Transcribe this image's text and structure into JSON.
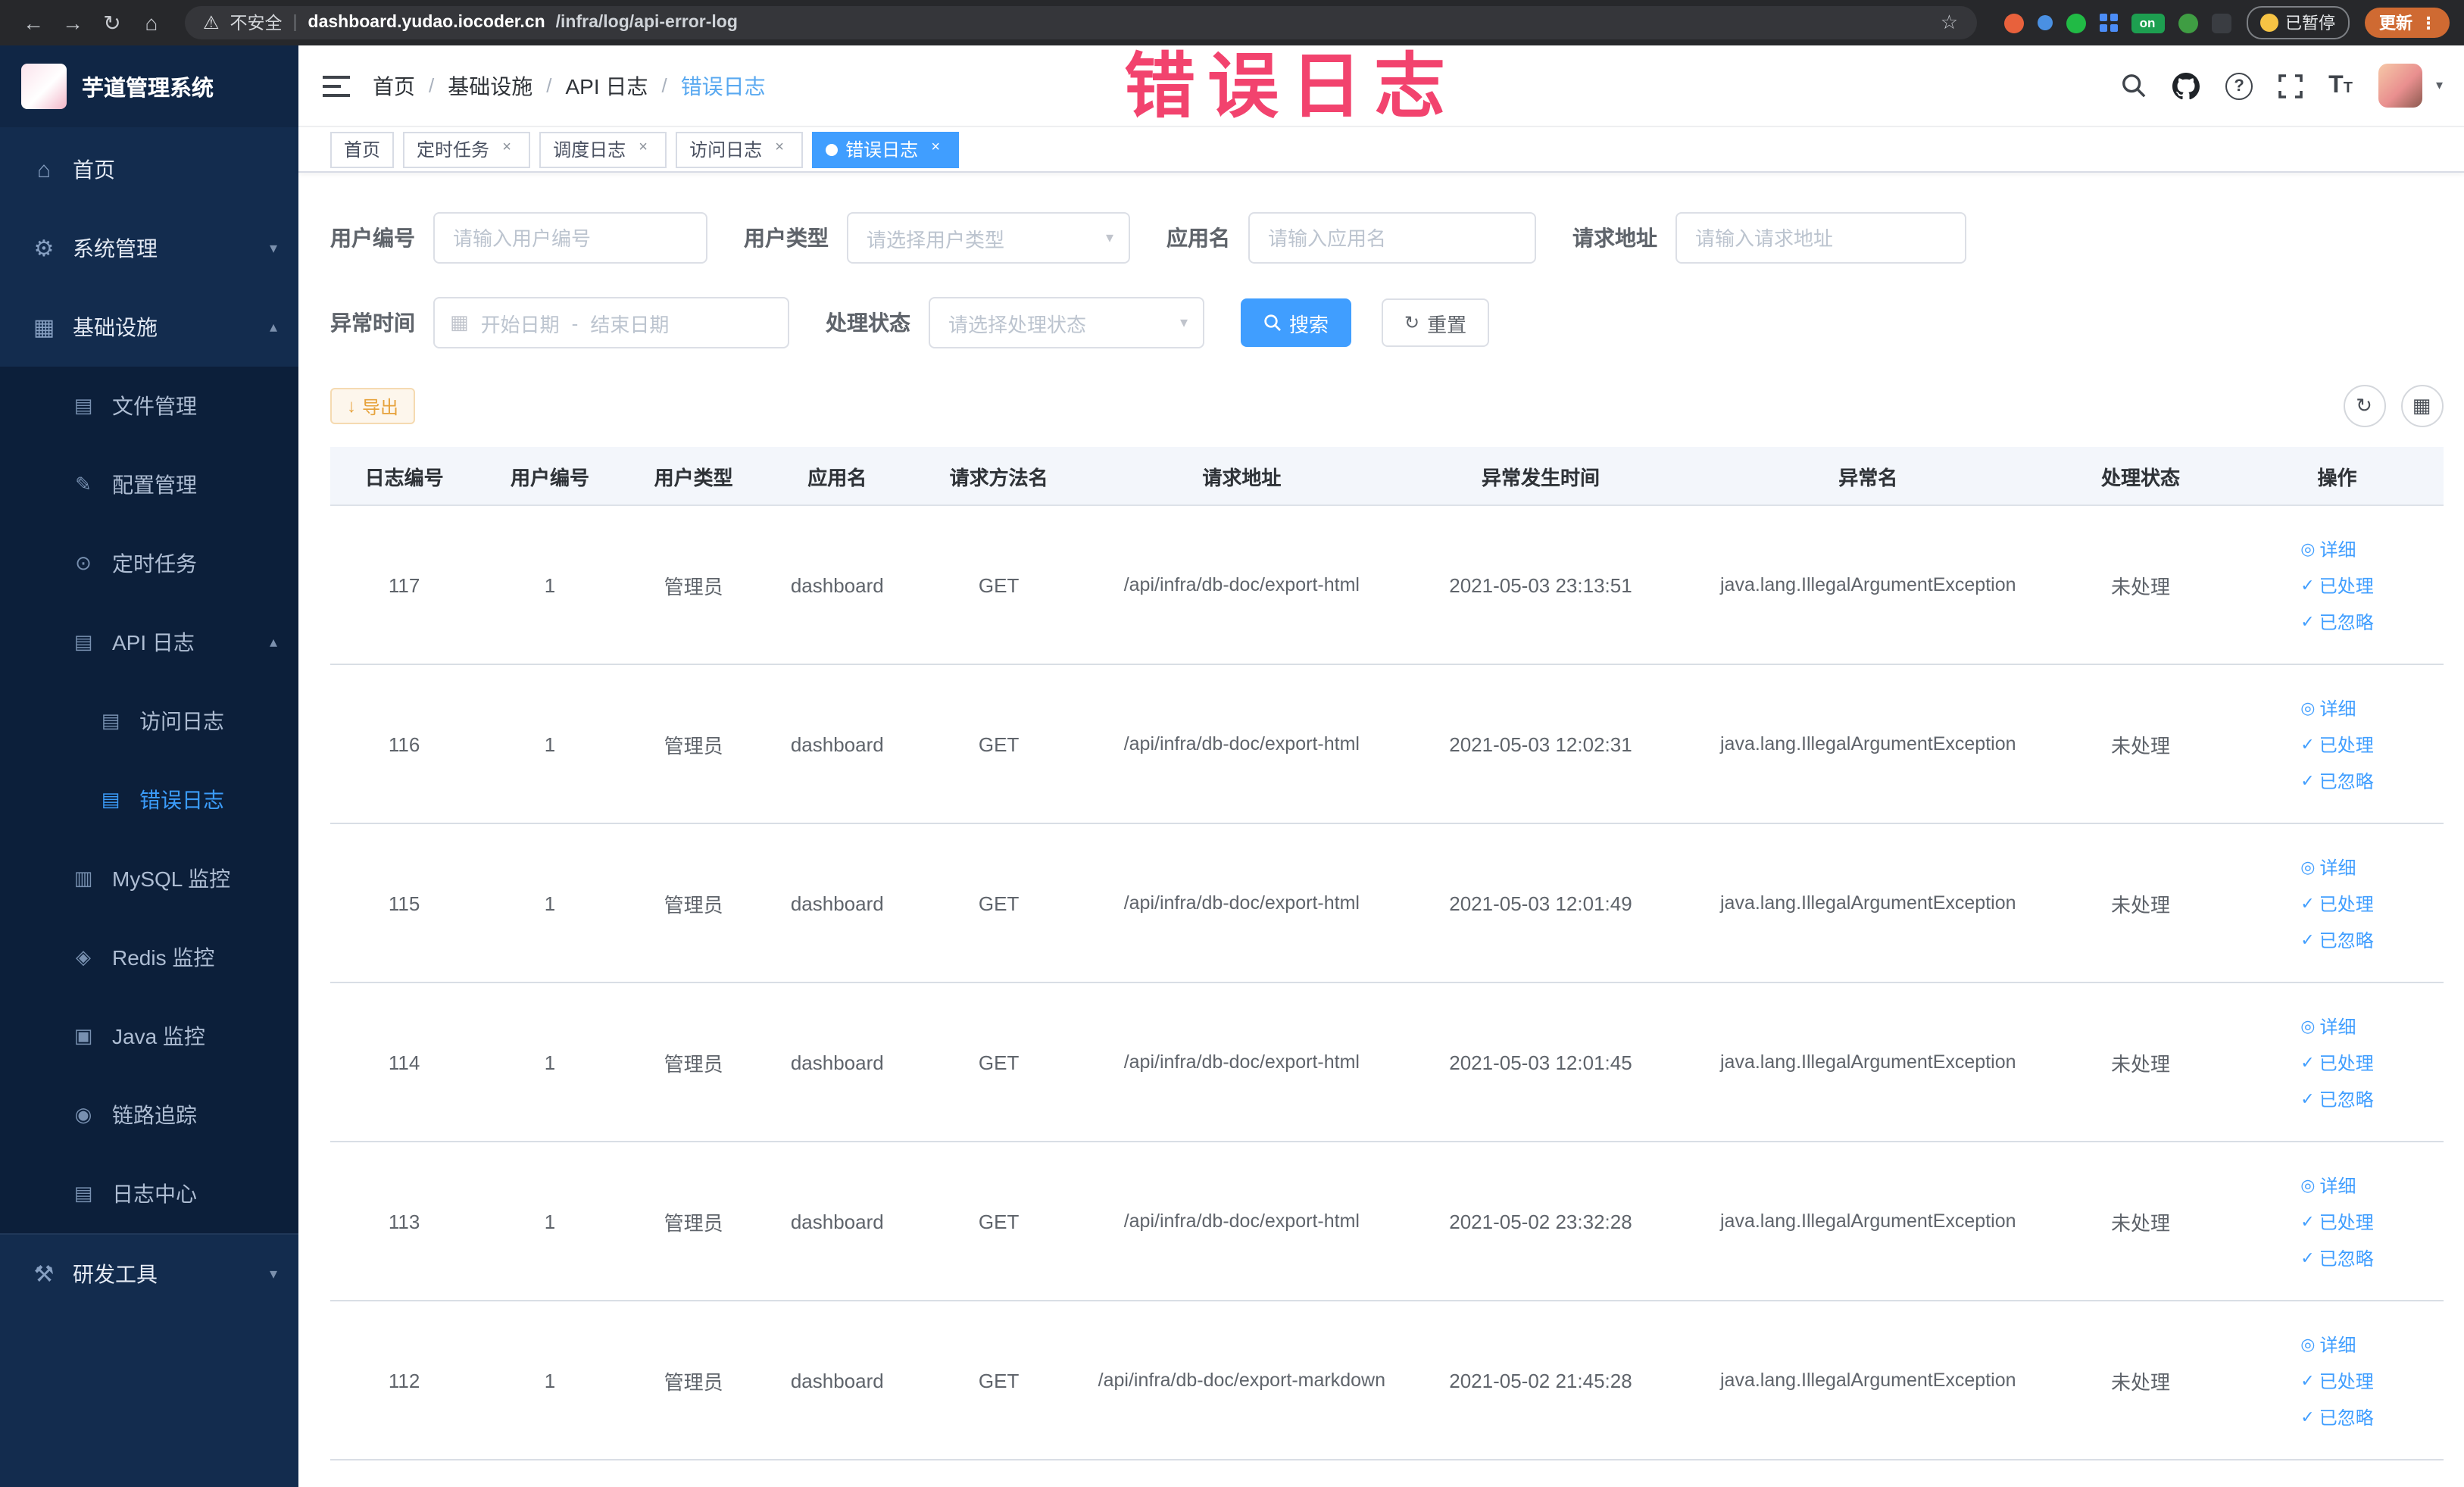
{
  "colors": {
    "primary": "#409eff",
    "annotation": "#f2436e",
    "warning_button": "#e6a23c",
    "active_tab": "#409eff"
  },
  "browser": {
    "insecure_label": "不安全",
    "url_domain": "dashboard.yudao.iocoder.cn",
    "url_path": "/infra/log/api-error-log",
    "paused_badge": "已暂停",
    "update_button": "更新",
    "extension_on_badge": "on"
  },
  "annotation": {
    "text": "错误日志"
  },
  "sidebar": {
    "title": "芋道管理系统",
    "menu": [
      {
        "label": "首页"
      },
      {
        "label": "系统管理"
      },
      {
        "label": "基础设施"
      },
      {
        "label": "文件管理"
      },
      {
        "label": "配置管理"
      },
      {
        "label": "定时任务"
      },
      {
        "label": "API 日志"
      },
      {
        "label": "访问日志"
      },
      {
        "label": "错误日志"
      },
      {
        "label": "MySQL 监控"
      },
      {
        "label": "Redis 监控"
      },
      {
        "label": "Java 监控"
      },
      {
        "label": "链路追踪"
      },
      {
        "label": "日志中心"
      },
      {
        "label": "研发工具"
      }
    ]
  },
  "navbar": {
    "breadcrumb": [
      "首页",
      "基础设施",
      "API 日志",
      "错误日志"
    ]
  },
  "tabs": [
    {
      "label": "首页"
    },
    {
      "label": "定时任务"
    },
    {
      "label": "调度日志"
    },
    {
      "label": "访问日志"
    },
    {
      "label": "错误日志"
    }
  ],
  "search": {
    "fields": {
      "user_id": {
        "label": "用户编号",
        "placeholder": "请输入用户编号"
      },
      "user_type": {
        "label": "用户类型",
        "placeholder": "请选择用户类型"
      },
      "app_name": {
        "label": "应用名",
        "placeholder": "请输入应用名"
      },
      "request_url": {
        "label": "请求地址",
        "placeholder": "请输入请求地址"
      },
      "exception_time": {
        "label": "异常时间",
        "start_placeholder": "开始日期",
        "separator": "-",
        "end_placeholder": "结束日期"
      },
      "process_status": {
        "label": "处理状态",
        "placeholder": "请选择处理状态"
      }
    },
    "search_button": "搜索",
    "reset_button": "重置"
  },
  "toolbar": {
    "export_button": "导出"
  },
  "table": {
    "columns": [
      "日志编号",
      "用户编号",
      "用户类型",
      "应用名",
      "请求方法名",
      "请求地址",
      "异常发生时间",
      "异常名",
      "处理状态",
      "操作"
    ],
    "actions": {
      "detail": "详细",
      "processed": "已处理",
      "ignored": "已忽略"
    },
    "rows": [
      {
        "log_id": "117",
        "user_id": "1",
        "user_type": "管理员",
        "app_name": "dashboard",
        "method": "GET",
        "url": "/api/infra/db-doc/export-html",
        "time": "2021-05-03 23:13:51",
        "exception": "java.lang.IllegalArgumentException",
        "status": "未处理"
      },
      {
        "log_id": "116",
        "user_id": "1",
        "user_type": "管理员",
        "app_name": "dashboard",
        "method": "GET",
        "url": "/api/infra/db-doc/export-html",
        "time": "2021-05-03 12:02:31",
        "exception": "java.lang.IllegalArgumentException",
        "status": "未处理"
      },
      {
        "log_id": "115",
        "user_id": "1",
        "user_type": "管理员",
        "app_name": "dashboard",
        "method": "GET",
        "url": "/api/infra/db-doc/export-html",
        "time": "2021-05-03 12:01:49",
        "exception": "java.lang.IllegalArgumentException",
        "status": "未处理"
      },
      {
        "log_id": "114",
        "user_id": "1",
        "user_type": "管理员",
        "app_name": "dashboard",
        "method": "GET",
        "url": "/api/infra/db-doc/export-html",
        "time": "2021-05-03 12:01:45",
        "exception": "java.lang.IllegalArgumentException",
        "status": "未处理"
      },
      {
        "log_id": "113",
        "user_id": "1",
        "user_type": "管理员",
        "app_name": "dashboard",
        "method": "GET",
        "url": "/api/infra/db-doc/export-html",
        "time": "2021-05-02 23:32:28",
        "exception": "java.lang.IllegalArgumentException",
        "status": "未处理"
      },
      {
        "log_id": "112",
        "user_id": "1",
        "user_type": "管理员",
        "app_name": "dashboard",
        "method": "GET",
        "url": "/api/infra/db-doc/export-markdown",
        "time": "2021-05-02 21:45:28",
        "exception": "java.lang.IllegalArgumentException",
        "status": "未处理"
      }
    ]
  }
}
